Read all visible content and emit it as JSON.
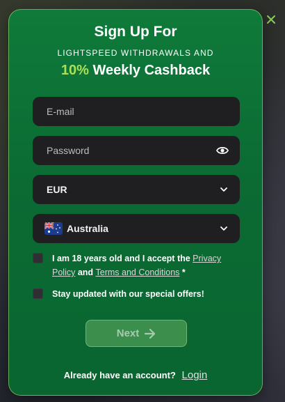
{
  "modal": {
    "title": "Sign Up For",
    "subtitle": "LIGHTSPEED WITHDRAWALS AND",
    "headline_accent": "10%",
    "headline_rest": " Weekly Cashback"
  },
  "form": {
    "email": {
      "placeholder": "E-mail",
      "value": ""
    },
    "password": {
      "placeholder": "Password",
      "value": ""
    },
    "currency": {
      "selected": "EUR"
    },
    "country": {
      "selected": "Australia"
    }
  },
  "consent": {
    "age_text_1": "I am 18 years old and I accept the ",
    "privacy_link": "Privacy Policy",
    "and_text": " and ",
    "terms_link": "Terms and Conditions",
    "required_mark": " *",
    "offers_text": "Stay updated with our special offers!"
  },
  "actions": {
    "next_label": "Next"
  },
  "footer": {
    "prompt": "Already have an account?",
    "login_label": "Login"
  },
  "colors": {
    "accent": "#a8e05a",
    "modal_green": "#0f7a3a",
    "field_bg": "#1f1f22",
    "close_icon": "#8fd45a"
  },
  "icons": [
    "close-icon",
    "eye-icon",
    "chevron-down-icon",
    "australia-flag-icon",
    "arrow-right-icon"
  ]
}
